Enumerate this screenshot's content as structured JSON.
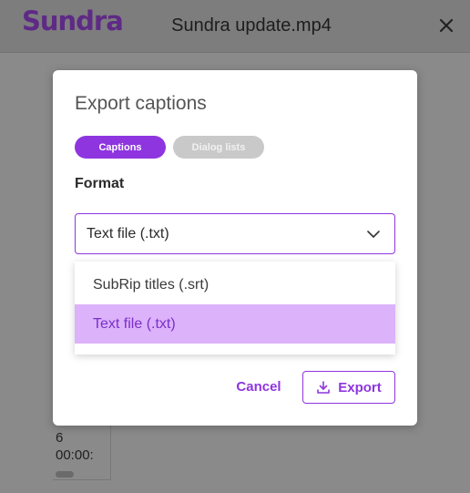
{
  "app": {
    "logo_text": "Sundra",
    "file_title": "Sundra update.mp4",
    "close_icon": "close-icon"
  },
  "background": {
    "row_number": "6",
    "timestamp": "00:00:"
  },
  "modal": {
    "title": "Export captions",
    "tabs": [
      {
        "label": "Captions",
        "active": true
      },
      {
        "label": "Dialog lists",
        "active": false
      }
    ],
    "format_label": "Format",
    "select": {
      "value": "Text file (.txt)",
      "icon": "chevron-down-icon"
    },
    "options": [
      {
        "label": "SubRip titles (.srt)",
        "selected": false
      },
      {
        "label": "Text file (.txt)",
        "selected": true
      }
    ],
    "cancel_label": "Cancel",
    "export_label": "Export",
    "export_icon": "download-icon"
  },
  "colors": {
    "accent": "#8e35e0",
    "selected_bg": "#dcb2fb",
    "overlay": "#8a8a8a"
  }
}
